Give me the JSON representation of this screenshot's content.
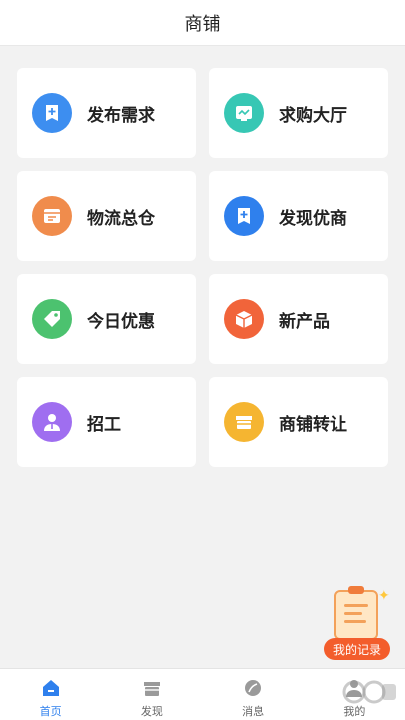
{
  "header": {
    "title": "商铺"
  },
  "cards": [
    {
      "label": "发布需求",
      "icon": "post-demand-icon",
      "color": "#3d8ef0"
    },
    {
      "label": "求购大厅",
      "icon": "purchase-hall-icon",
      "color": "#37c7b4"
    },
    {
      "label": "物流总仓",
      "icon": "logistics-icon",
      "color": "#f08c4c"
    },
    {
      "label": "发现优商",
      "icon": "discover-merchant-icon",
      "color": "#2f80ed"
    },
    {
      "label": "今日优惠",
      "icon": "tag-icon",
      "color": "#4cc26f"
    },
    {
      "label": "新产品",
      "icon": "box-icon",
      "color": "#f1643a"
    },
    {
      "label": "招工",
      "icon": "worker-icon",
      "color": "#9f6ef0"
    },
    {
      "label": "商铺转让",
      "icon": "store-transfer-icon",
      "color": "#f5b531"
    }
  ],
  "float": {
    "label": "我的记录"
  },
  "tabbar": {
    "items": [
      {
        "label": "首页",
        "icon": "home-icon",
        "active": true
      },
      {
        "label": "发现",
        "icon": "shop-icon",
        "active": false
      },
      {
        "label": "消息",
        "icon": "leaf-icon",
        "active": false
      },
      {
        "label": "我的",
        "icon": "profile-icon",
        "active": false
      }
    ]
  },
  "accent": "#2f80ed"
}
